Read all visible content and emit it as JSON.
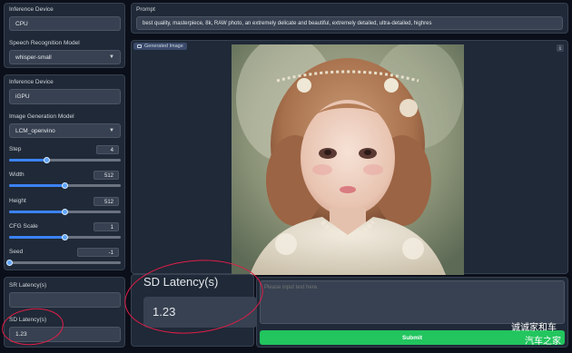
{
  "speech": {
    "device_label": "Inference Device",
    "device_value": "CPU",
    "model_label": "Speech Recognition Model",
    "model_value": "whisper-small"
  },
  "image_gen": {
    "device_label": "Inference Device",
    "device_value": "iGPU",
    "model_label": "Image Generation Model",
    "model_value": "LCM_openvino",
    "sliders": [
      {
        "label": "Step",
        "value": "4",
        "min": 1,
        "max": 10,
        "current": 4
      },
      {
        "label": "Width",
        "value": "512",
        "min": 256,
        "max": 768,
        "current": 512
      },
      {
        "label": "Height",
        "value": "512",
        "min": 256,
        "max": 768,
        "current": 512
      },
      {
        "label": "CFG Scale",
        "value": "1",
        "min": 0,
        "max": 2,
        "current": 1
      },
      {
        "label": "Seed",
        "value": "-1",
        "min": -1,
        "max": 0,
        "current": -1
      }
    ]
  },
  "latency": {
    "sr_label": "SR Latency(s)",
    "sr_value": "",
    "sd_label": "SD Latency(s)",
    "sd_value": "1.23",
    "big_label": "SD Latency(s)",
    "big_value": "1.23"
  },
  "prompt": {
    "label": "Prompt",
    "value": "best quality, masterpiece, 8k, RAW photo, an extremely delicate and beautiful, extremely detailed, ultra-detailed, highres"
  },
  "output": {
    "tag_label": "Generated Image",
    "text_placeholder": "Please input text here.",
    "submit_label": "Submit"
  },
  "watermark": {
    "line1": "诚诚家和车",
    "line2": "汽车之家"
  },
  "colors": {
    "accent": "#3b82f6",
    "submit": "#22c55e",
    "annotation": "#e11d48"
  }
}
